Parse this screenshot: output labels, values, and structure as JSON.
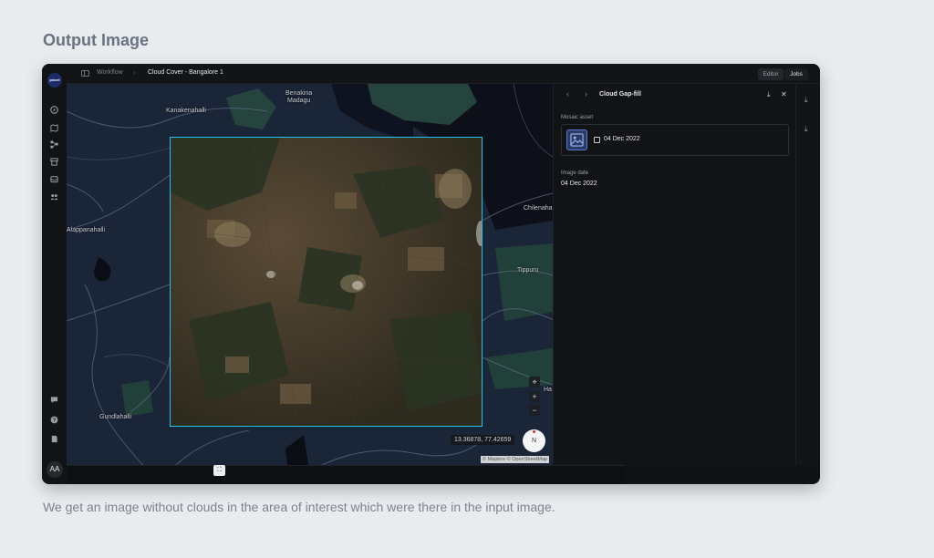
{
  "slide": {
    "title": "Output Image",
    "caption": "We get an image without clouds in the area of interest which were there in the input image."
  },
  "app": {
    "logo_text": "pixxel",
    "avatar_initials": "AA",
    "breadcrumb": {
      "root": "Workflow",
      "separator": "›",
      "current": "Cloud Cover - Bangalore 1"
    },
    "tabs": {
      "editor": "Editor",
      "jobs": "Jobs"
    },
    "rail_icons": [
      "compass-icon",
      "map-icon",
      "workflow-icon",
      "store-icon",
      "inbox-icon",
      "team-icon",
      "feedback-icon",
      "help-icon",
      "docs-icon"
    ]
  },
  "map": {
    "labels": {
      "benakina": "Benakina",
      "madagu": "Madagu",
      "kanakenahalli": "Kanakenahalli",
      "alappanahalli": "Alappanahalli",
      "chilenahalli": "Chilenaha",
      "tippuru": "Tippuru",
      "gundlahalli": "Gundlahalli",
      "ha": "Ha"
    },
    "coordinates": "13.36878, 77.42659",
    "compass": "N",
    "attribution": "© Mapbox © OpenStreetMap",
    "controls": {
      "locate": "⌖",
      "zoom_in": "+",
      "zoom_out": "−",
      "fullscreen": "⛶"
    },
    "colors": {
      "background": "#1b2538",
      "water": "#0d1018",
      "park": "#25443e",
      "aoi_border": "#1fc4e8"
    }
  },
  "panel": {
    "title": "Cloud Gap-fill",
    "back": "‹",
    "forward": "›",
    "download": "⤓",
    "close": "✕",
    "mosaic_label": "Mosaic asset",
    "mosaic_date": "04 Dec 2022",
    "image_date_label": "Image date",
    "image_date_value": "04 Dec 2022"
  }
}
